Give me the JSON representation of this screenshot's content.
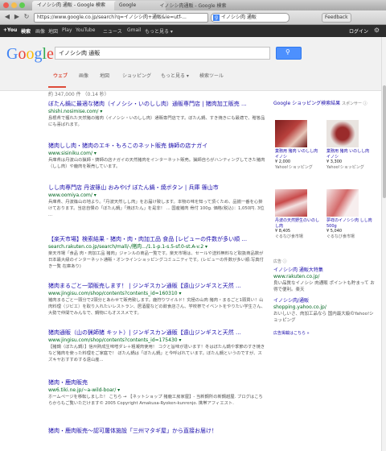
{
  "browser": {
    "tabs": [
      "イノシシ肉 通販 - Google 検索",
      "Google"
    ],
    "window_title": "イノシシ肉通販 - Google 検索",
    "url": "https://www.google.co.jp/search?q=イノシシ肉+通販&ie=utf-...",
    "search_box": "イノシシ肉 通販",
    "feedback": "Feedback"
  },
  "gbar": {
    "items": [
      "+You",
      "検索",
      "画像",
      "地図",
      "Play",
      "YouTube",
      "ニュース",
      "Gmail",
      "もっと見る ▾"
    ],
    "signin": "ログイン"
  },
  "search": {
    "logo": "Google",
    "query": "イノシシ肉 通販",
    "tabs": [
      "ウェブ",
      "画像",
      "地図",
      "ショッピング",
      "もっと見る ▾",
      "検索ツール"
    ],
    "stats": "約 347,000 件 （0.14 秒）"
  },
  "results": [
    {
      "title": "ぼたん鍋に最適な猪肉（イノシシ・いのしし肉）通販専門店 | 猪肉加工販売 ...",
      "url": "shishi.nosimise.com/ ▾",
      "snippet": "島根県で獲れた天然猪の猪肉（イノシシ・いのしし肉）通販専門店です。ぼたん鍋、すき焼きにも最適で、贈答品にも喜ばれます。"
    },
    {
      "title": "猪肉しし肉・猪肉のエキ・もろこのネット販売 鋳師の店ナガイ",
      "url": "www.sisiniku.com/ ▾",
      "snippet": "兵庫県は丹波山の猟師・鋳師の店ナガイの天然猪肉をインターネット販売。猟師自らがハンティングしてきた猪肉（しし肉）や鹿肉を販売しています。"
    },
    {
      "title": "しし肉専門店 丹波篠山 おみやげ ぼたん鍋・焼ボタン | 兵庫 篠山市",
      "url": "www.oomiya.com/ ▾",
      "snippet": "兵庫県、丹波篠山の地より。「丹波天然しし肉」をお届け致します。本物の味を知って頂くため、品揃一番を心掛けております。当店自慢の「ぼたん鍋」「焼ぼたん」を是非！ ... 国産猪肉 骨付 100g. 価格(税込)：1,050円. 3位 ..."
    },
    {
      "title": "【楽天市場】検索結果 - 猪肉・肉・肉加工品 食品 [レビューの件数が多い順 ...",
      "url": "search.rakuten.co.jp/search/mall/-/猪肉.../1.1-p.1-s.5-sf.0-st.A-v.2 ▾",
      "snippet": "楽天市場「食品 肉・肉加工品 猪肉」ジャンルの商品一覧です。楽天市場は、セールや送料無料など取扱商品数が日本最大級のインターネット通販・オンラインショッピングコミュニティです。(レビューの件数が多い順:写真付き一覧 在庫あり)"
    },
    {
      "title": "猪肉まるごと一頭販売します！ | ジンギスカン通販【遠山ジンギスと天然 ...",
      "url": "www.jingisu.com/shop/contents?contents_id=160310 ▾",
      "snippet": "猪肉まるごと一頭分で2頭分とあわせて販売致します。鹿狩りワイルド！究極の山肉 猪肉・まるごと1頭買い！山肉料理（ジビエ）を取り入れたいレストラン、居酒屋などの飲食店さん、学校祭でイベントをやりたい学生さん、大勢で仲間でみんなで、鍋物にもオススメです。"
    },
    {
      "title": "猪肉通販（山の猟師猪 キット）| ジンギスカン通販【遠山ジンギスと天然 ...",
      "url": "www.jingisu.com/shop/contents?contents_id=175430 ▾",
      "snippet": "【猪鍋（ぼたん鍋）】信州熟成生味噌ダレ＋粗凝肉使用！ コクと旨味が違います！冬はぼたん鍋や季節のすき焼きなど猪肉を使った料理をご家庭で！ ぼたん鍋は「ぼたん鍋」と今呼ばれています。ぼたん鍋というのですが、スズキヤおすすめする遠山産..."
    },
    {
      "title": "猪肉・鹿肉販売",
      "url": "ww6.tiki.ne.jp/~a-wild-boar/ ▾",
      "snippet": "ホームページを移転しました！ こちら → 【ネットショップ 猪鹿工房家屋】- 当新鋼所の新鋼越屋. ブログはこちらからもご覧いただけます© 2005 Copyright Amakusa-Ryoken-kunrenjo. 携帯アフィエスト."
    },
    {
      "title": "猪肉・鹿肉販売～認可屠体施設「三州マタギ屋」から直接お届け！",
      "url": "",
      "snippet": ""
    }
  ],
  "shopping": {
    "header": "Google ショッピング検索結果",
    "sponsor": "スポンサー ⓘ",
    "products": [
      {
        "title": "業務用 猪肉 いのしし肉 イノシ",
        "price": "¥ 2,000",
        "store": "Yahoo!ショッピング"
      },
      {
        "title": "業務用 猪肉 いのしし肉 イノシ",
        "price": "¥ 3,300",
        "store": "Yahoo!ショッピング"
      },
      {
        "title": "丹波の天然野生のいのしし肉",
        "price": "¥ 8,405",
        "store": "ぐるなび食市場"
      },
      {
        "title": "夢祥のイノシシ肉 しし肉 500g",
        "price": "¥ 5,040",
        "store": "ぐるなび食市場"
      }
    ]
  },
  "ads": {
    "label": "広告 ⓘ",
    "items": [
      {
        "title": "イノシシ肉 通販大特集",
        "url": "www.rakuten.co.jp/",
        "desc": "良い品質なイノシシ 肉通販 ポイントも貯まって お得で便利。楽天"
      },
      {
        "title": "イノシシ肉/通販",
        "url": "shopping.yahoo.co.jp/",
        "desc": "おいしいさ、肉加工品なら 国内最大級のYahoo!ショッピング"
      }
    ],
    "more": "広告掲載はこちら »"
  }
}
